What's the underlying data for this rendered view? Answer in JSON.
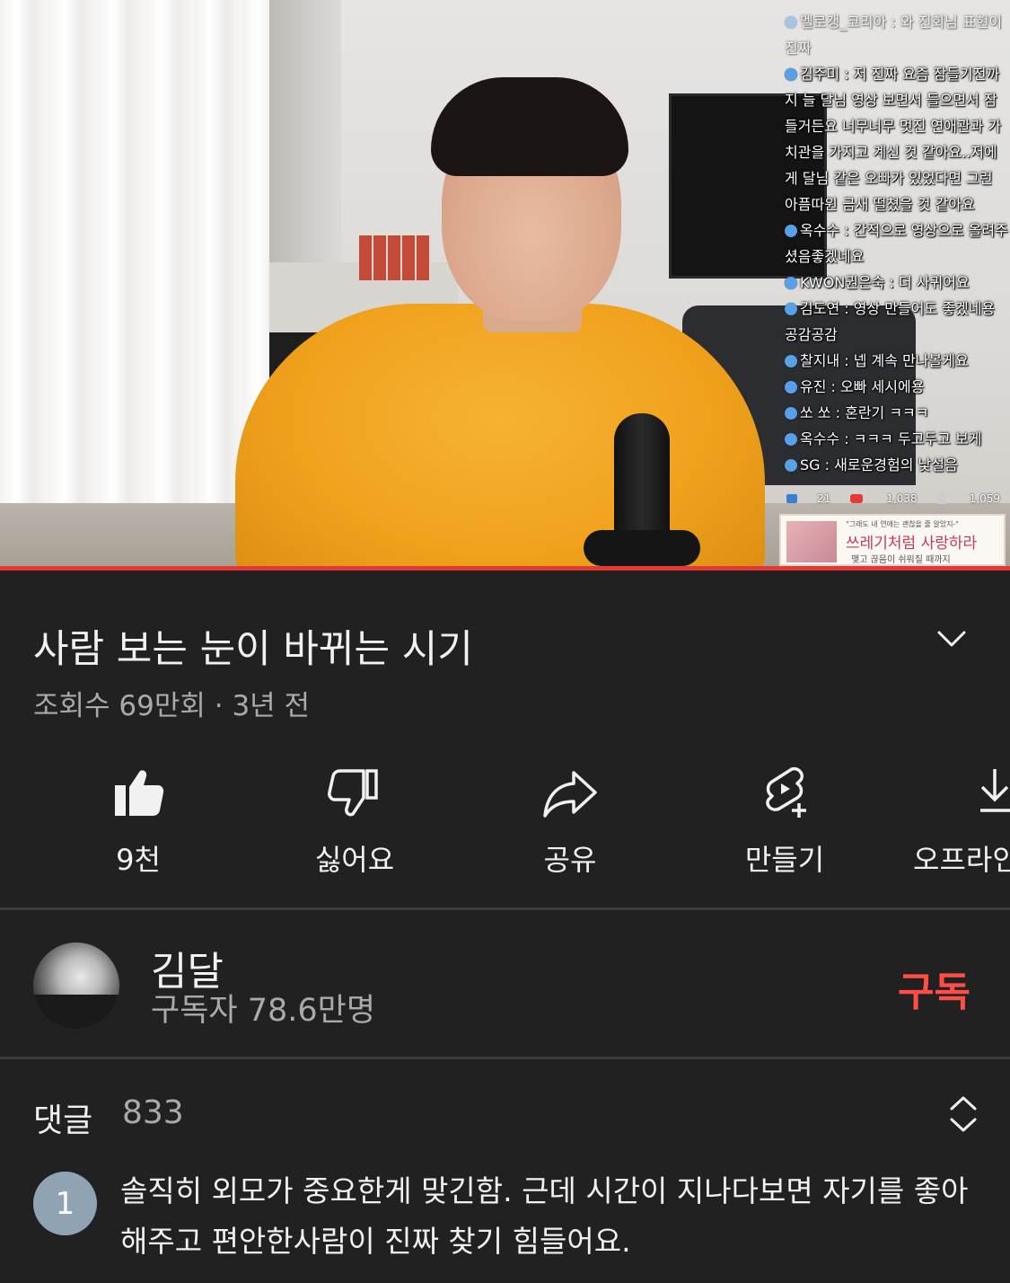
{
  "video": {
    "chat": [
      {
        "user": "멜로갱_코리아",
        "text": "와 진회님 표현이 진짜"
      },
      {
        "user": "김주미",
        "text": "저 진짜 요즘 잠들기전까지 늘 달님 영상 보면서 들으면서 잠들거든요 너무너무 멋진 연애관과 가치관을 가지고 계신 것 같아요..저에게 달님 같은 오빠가 있었다면 그런 아픔따윈 금새 떨쳤을 것 같아요"
      },
      {
        "user": "옥수수",
        "text": "간적으로 영상으로 올려주셨음좋겠네요"
      },
      {
        "user": "KWON권은숙",
        "text": "더 사귀어요"
      },
      {
        "user": "김도연",
        "text": "영상 만들어도 좋겠네용 공감공감"
      },
      {
        "user": "찰지내",
        "text": "넵 계속 만나볼게요"
      },
      {
        "user": "유진",
        "text": "오빠 세시에용"
      },
      {
        "user": "쏘 쏘",
        "text": "혼란기 ㅋㅋㅋ"
      },
      {
        "user": "옥수수",
        "text": "ㅋㅋㅋ 두고두고 보게"
      },
      {
        "user": "SG",
        "text": "새로운경험의 낯설음"
      }
    ],
    "stats": {
      "likes": "21",
      "views": "1,038",
      "viewers": "1,059"
    },
    "book_ad": {
      "tagline": "\"그래도 내 연애는 괜찮을 줄 알았지-\"",
      "title": "쓰레기처럼 사랑하라",
      "subtitle": "맺고 끊음이 쉬워질 때까지"
    },
    "progress_fraction": 1.0
  },
  "title": "사람 보는 눈이 바뀌는 시기",
  "meta": "조회수 69만회 · 3년 전",
  "actions": {
    "like": "9천",
    "dislike": "싫어요",
    "share": "공유",
    "create": "만들기",
    "offline": "오프라인"
  },
  "channel": {
    "name": "김달",
    "subscribers": "구독자 78.6만명",
    "subscribe_label": "구독"
  },
  "comments": {
    "label": "댓글",
    "count": "833",
    "first": {
      "avatar_initial": "1",
      "text": "솔직히 외모가 중요한게 맞긴함. 근데 시간이 지나다보면 자기를 좋아해주고 편안한사람이 진짜 찾기 힘들어요."
    }
  },
  "colors": {
    "background": "#212121",
    "accent": "#ff4e45",
    "progress": "#e53935",
    "secondary_text": "#aaaaaa"
  }
}
